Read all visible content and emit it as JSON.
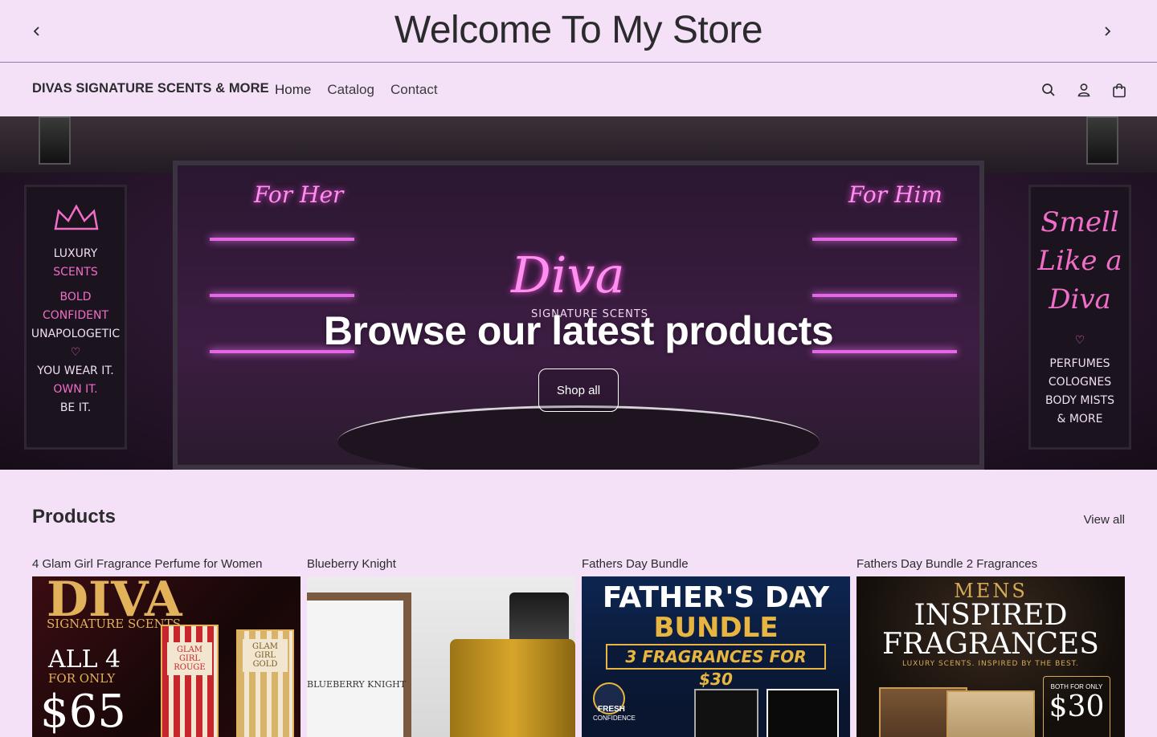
{
  "announcement": {
    "title": "Welcome To My Store"
  },
  "header": {
    "brand": "DIVAS SIGNATURE SCENTS & MORE",
    "nav": [
      {
        "label": "Home"
      },
      {
        "label": "Catalog"
      },
      {
        "label": "Contact"
      }
    ],
    "icons": [
      "search-icon",
      "account-icon",
      "cart-icon"
    ]
  },
  "hero": {
    "heading": "Browse our latest products",
    "button_label": "Shop all",
    "left_panel": {
      "lines": [
        "LUXURY",
        "SCENTS",
        "BOLD",
        "CONFIDENT",
        "UNAPOLOGETIC",
        "♡",
        "YOU WEAR IT.",
        "OWN IT.",
        "BE IT."
      ]
    },
    "right_panel": {
      "script": [
        "Smell",
        "Like a",
        "Diva"
      ],
      "lines": [
        "PERFUMES",
        "COLOGNES",
        "BODY MISTS",
        "& MORE"
      ]
    },
    "neon_her": "For Her",
    "neon_him": "For Him",
    "neon_logo": "Diva",
    "neon_sub": "SIGNATURE SCENTS"
  },
  "products": {
    "title": "Products",
    "view_all": "View all",
    "items": [
      {
        "name": "4 Glam Girl Fragrance Perfume for Women",
        "img": {
          "line1": "DIVA",
          "line2": "SIGNATURE SCENTS",
          "line3": "ALL 4",
          "line4": "FOR ONLY",
          "price": "$65",
          "box1": "GLAM GIRL ROUGE",
          "box2": "GLAM GIRL GOLD"
        }
      },
      {
        "name": "Blueberry Knight",
        "img": {
          "label": "BLUEBERRY KNIGHT"
        }
      },
      {
        "name": "Fathers Day Bundle",
        "img": {
          "line1": "FATHER'S DAY",
          "line2": "BUNDLE",
          "line3": "3 FRAGRANCES FOR $30",
          "badge": "FRESH",
          "badge2": "CONFIDENCE"
        }
      },
      {
        "name": "Fathers Day Bundle 2 Fragrances",
        "img": {
          "line1": "MENS",
          "line2": "INSPIRED",
          "line3": "FRAGRANCES",
          "line4": "LUXURY SCENTS. INSPIRED BY THE BEST.",
          "badge": "BOTH FOR ONLY",
          "price": "$30"
        }
      }
    ]
  },
  "colors": {
    "background": "#f4e1f7",
    "text": "#2b2b2e",
    "neon": "#ff8ff0"
  }
}
